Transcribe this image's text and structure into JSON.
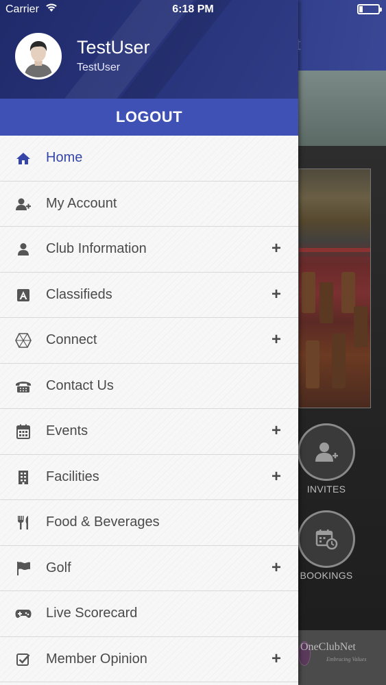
{
  "status_bar": {
    "carrier": "Carrier",
    "time": "6:18 PM"
  },
  "background": {
    "title_fragment": "t",
    "buttons": [
      {
        "label": "INVITES",
        "icon": "add-user-icon"
      },
      {
        "label": "BOOKINGS",
        "icon": "calendar-icon"
      }
    ],
    "footer_logo": "OneClubNet",
    "footer_tagline": "Embracing Values"
  },
  "drawer": {
    "user": {
      "name": "TestUser",
      "subtitle": "TestUser"
    },
    "logout_label": "LOGOUT",
    "accent_color": "#3f51b5",
    "items": [
      {
        "label": "Home",
        "icon": "home-icon",
        "expandable": false,
        "active": true
      },
      {
        "label": "My Account",
        "icon": "add-user-icon",
        "expandable": false
      },
      {
        "label": "Club Information",
        "icon": "person-icon",
        "expandable": true
      },
      {
        "label": "Classifieds",
        "icon": "classifieds-icon",
        "expandable": true
      },
      {
        "label": "Connect",
        "icon": "connect-icon",
        "expandable": true
      },
      {
        "label": "Contact Us",
        "icon": "phone-icon",
        "expandable": false
      },
      {
        "label": "Events",
        "icon": "calendar-icon",
        "expandable": true
      },
      {
        "label": "Facilities",
        "icon": "building-icon",
        "expandable": true
      },
      {
        "label": "Food & Beverages",
        "icon": "fork-knife-icon",
        "expandable": false
      },
      {
        "label": "Golf",
        "icon": "flag-icon",
        "expandable": true
      },
      {
        "label": "Live Scorecard",
        "icon": "gamepad-icon",
        "expandable": false
      },
      {
        "label": "Member Opinion",
        "icon": "checkbox-icon",
        "expandable": true
      }
    ],
    "expand_symbol": "+"
  }
}
